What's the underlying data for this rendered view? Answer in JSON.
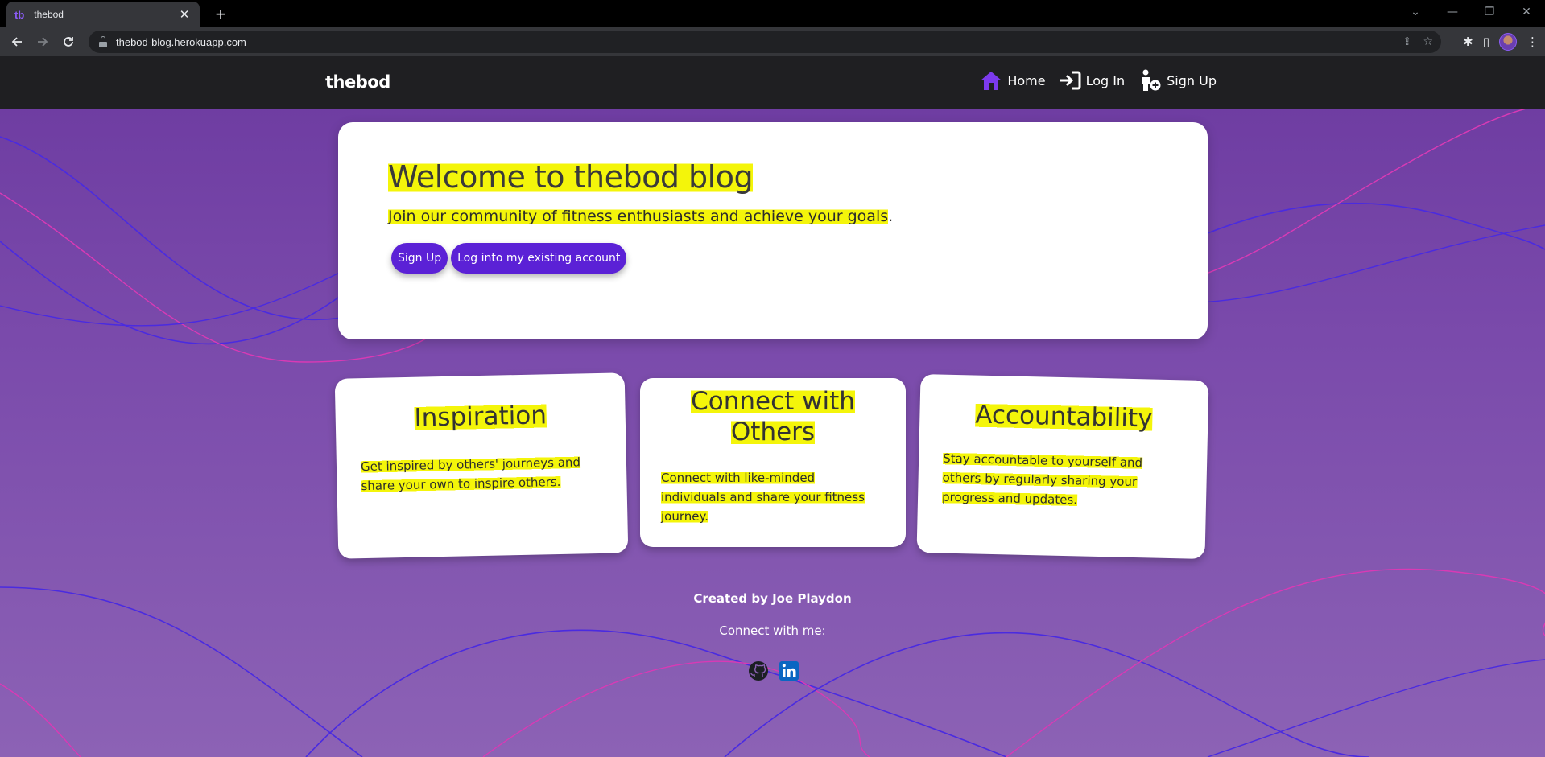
{
  "browser": {
    "tab_favicon": "tb",
    "tab_title": "thebod",
    "tab_close": "✕",
    "new_tab": "+",
    "url": "thebod-blog.herokuapp.com"
  },
  "site": {
    "brand": "thebod",
    "nav": {
      "home": "Home",
      "login": "Log In",
      "signup": "Sign Up"
    }
  },
  "hero": {
    "title": "Welcome to thebod blog",
    "subtitle_highlighted": "Join our community of fitness enthusiasts and achieve your goals",
    "subtitle_end": ".",
    "signup_button": "Sign Up",
    "login_button": "Log into my existing account"
  },
  "cards": [
    {
      "title": "Inspiration",
      "text_line1": "Get inspired by others' journeys and",
      "text_line2": "share your own to inspire others."
    },
    {
      "title_line1": "Connect with",
      "title_line2": "Others",
      "text_line1": "Connect with like-minded",
      "text_line2": "individuals and share your fitness",
      "text_line3": "journey."
    },
    {
      "title": "Accountability",
      "text_line1": "Stay accountable to yourself and",
      "text_line2": "others by regularly sharing your",
      "text_line3": "progress and updates."
    }
  ],
  "footer": {
    "created": "Created by Joe Playdon",
    "connect": "Connect with me:",
    "icons": [
      "github-icon",
      "linkedin-icon"
    ]
  },
  "colors": {
    "accent": "#5b21d6",
    "highlight": "#f4f50a",
    "nav_bg": "#1f1f22",
    "page_bg": "#7a4aab"
  }
}
